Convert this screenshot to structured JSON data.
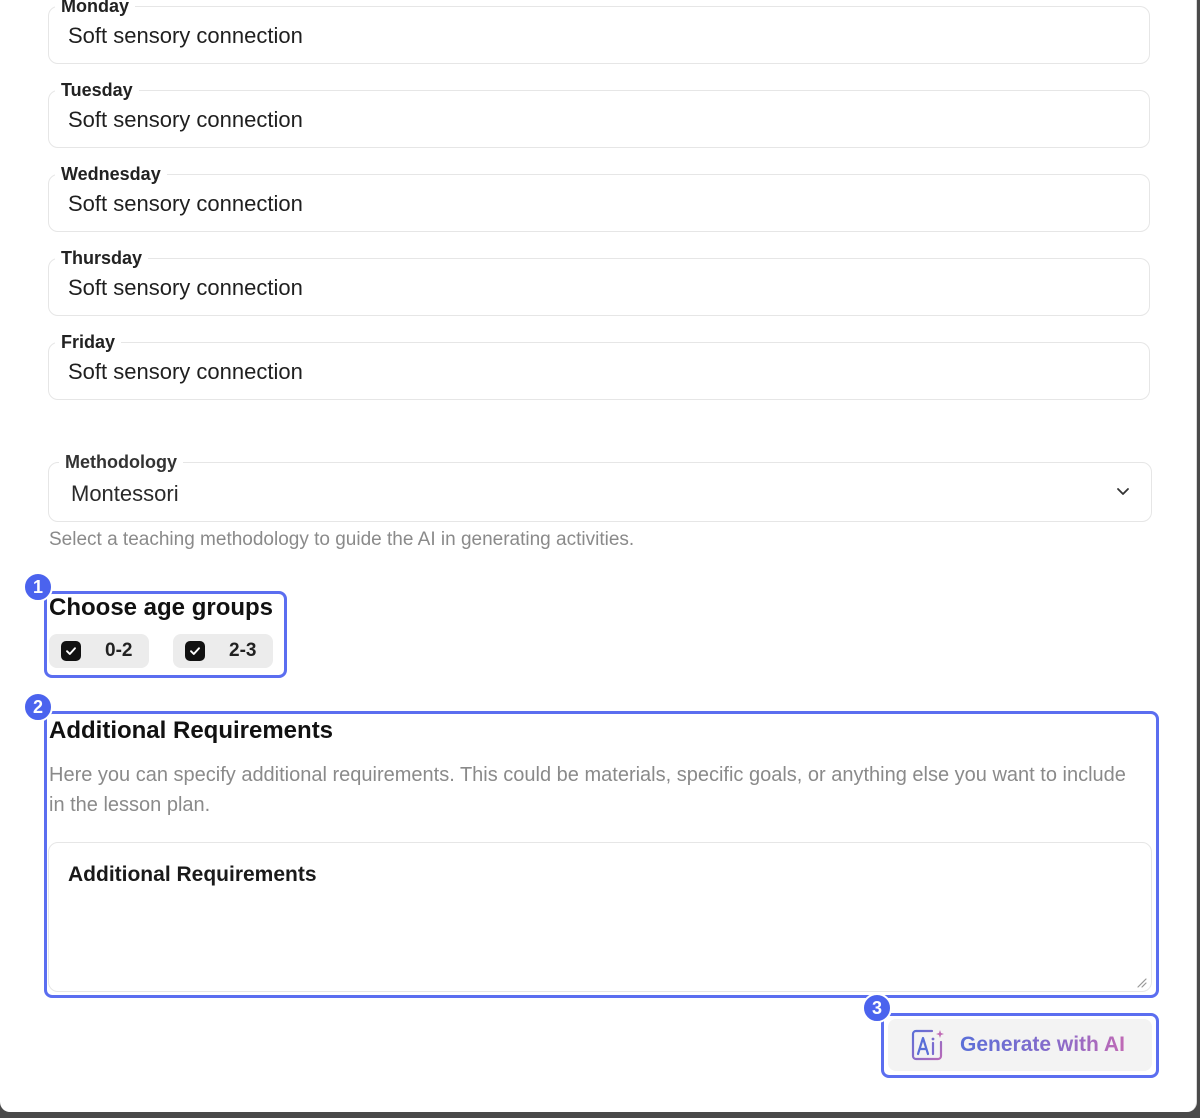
{
  "days": [
    {
      "label": "Monday",
      "value": "Soft sensory connection"
    },
    {
      "label": "Tuesday",
      "value": "Soft sensory connection"
    },
    {
      "label": "Wednesday",
      "value": "Soft sensory connection"
    },
    {
      "label": "Thursday",
      "value": "Soft sensory connection"
    },
    {
      "label": "Friday",
      "value": "Soft sensory connection"
    }
  ],
  "methodology": {
    "label": "Methodology",
    "selected": "Montessori",
    "helper": "Select a teaching methodology to guide the AI in generating activities."
  },
  "age_groups": {
    "title": "Choose age groups",
    "options": [
      {
        "label": "0-2",
        "checked": true
      },
      {
        "label": "2-3",
        "checked": true
      }
    ]
  },
  "additional": {
    "title": "Additional Requirements",
    "description": "Here you can specify additional requirements. This could be materials, specific goals, or anything else you want to include in the lesson plan.",
    "field_label": "Additional Requirements"
  },
  "generate": {
    "label": "Generate with AI"
  },
  "annotations": {
    "badge_1": "1",
    "badge_2": "2",
    "badge_3": "3",
    "highlight_color": "#5b6ef0",
    "badge_color": "#4b63ee"
  },
  "icons": {
    "chevron": "chevron-down-icon",
    "checkbox": "check-icon",
    "ai": "ai-sparkle-icon",
    "resize": "resize-handle-icon"
  }
}
